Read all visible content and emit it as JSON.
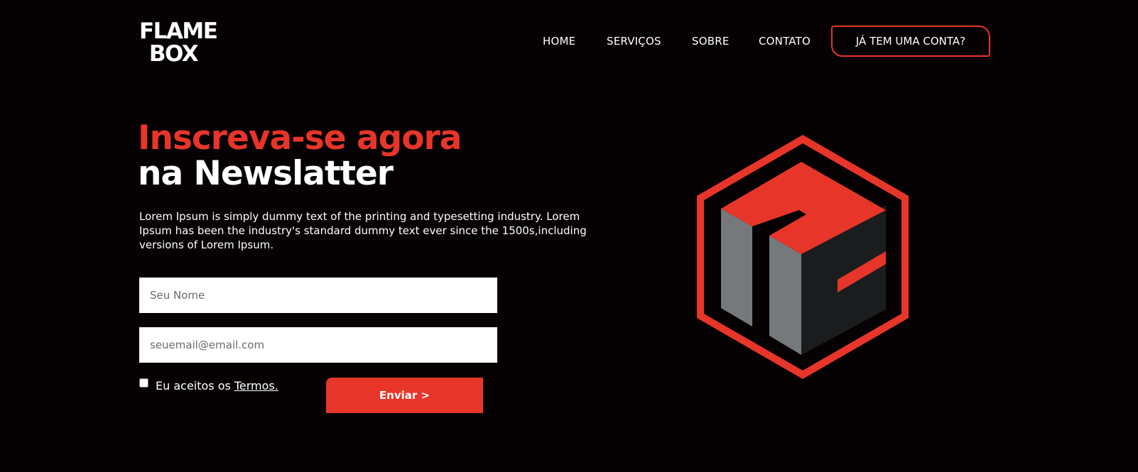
{
  "brand": {
    "line1": "FLAME",
    "line2": "BOX"
  },
  "nav": {
    "items": [
      {
        "label": "HOME"
      },
      {
        "label": "SERVIÇOS"
      },
      {
        "label": "SOBRE"
      },
      {
        "label": "CONTATO"
      }
    ],
    "account_label": "JÁ TEM UMA CONTA?"
  },
  "hero": {
    "headline_accent": "Inscreva-se agora",
    "headline_main": "na Newslatter",
    "description": "Lorem Ipsum is simply dummy text of the printing and typesetting industry. Lorem Ipsum has been the industry's standard dummy text ever since the 1500s,including versions of Lorem Ipsum."
  },
  "form": {
    "name_placeholder": "Seu Nome",
    "email_placeholder": "seuemail@email.com",
    "terms_text": "Eu aceitos os",
    "terms_link": "Termos.",
    "submit_label": "Enviar >"
  },
  "colors": {
    "accent": "#e8352a",
    "background": "#060203",
    "emblem_gray": "#76797c",
    "emblem_dark": "#1b1c1e"
  },
  "icons": {
    "emblem": "hexagon-cube-logo-icon"
  }
}
